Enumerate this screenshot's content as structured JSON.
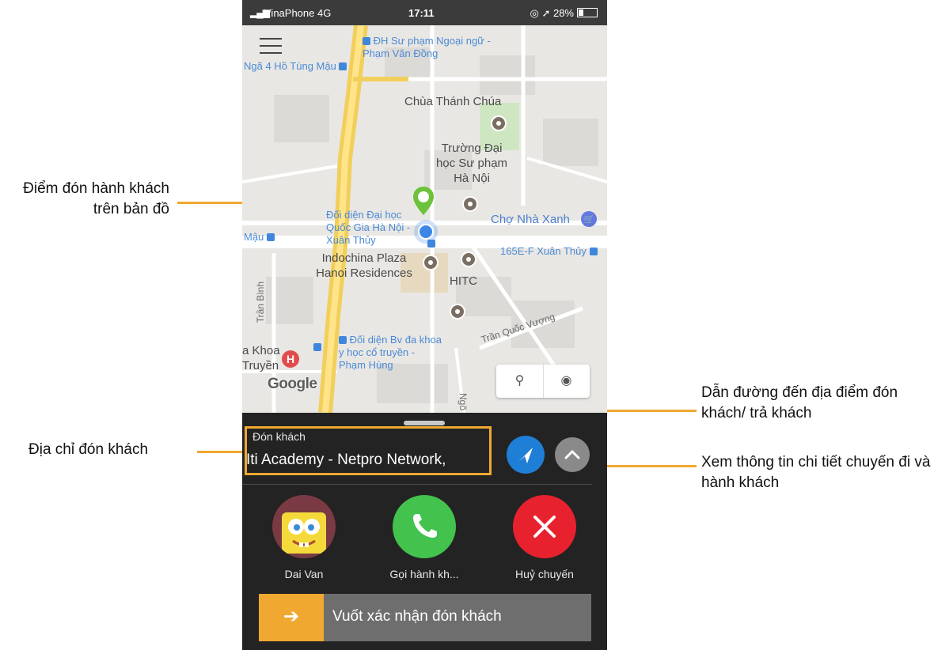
{
  "annotations": {
    "pickup_on_map": "Điểm đón hành khách trên bản đồ",
    "pickup_address": "Địa chỉ đón khách",
    "navigate": "Dẫn đường đến địa điểm đón khách/ trả khách",
    "trip_details": "Xem thông tin chi tiết chuyến đi và hành khách"
  },
  "status_bar": {
    "carrier": "VinaPhone  4G",
    "time": "17:11",
    "battery": "28%"
  },
  "map": {
    "pois": {
      "dhsp_ngoai_ngu": "ĐH Sư phạm Ngoại ngữ - Phạm Văn Đồng",
      "nga4_ho_tung_mau": "Ngã 4 Hồ Tùng Mậu",
      "chua": "Chùa Thánh Chúa",
      "truong": "Trường Đại học Sư phạm Hà Nội",
      "doi_dien_dhqg": "Đối diện Đại học Quốc Gia Hà Nội - Xuân Thủy",
      "cho_nha_xanh": "Chợ Nhà Xanh",
      "mau": "Mậu",
      "indochina": "Indochina Plaza Hanoi Residences",
      "stop_165": "165E-F Xuân Thủy",
      "hitc": "HITC",
      "tran_binh": "Trần Bình",
      "tran_quoc_vuong": "Trần Quốc Vượng",
      "doi_dien_bv": "Đối diện Bv đa khoa y học cổ truyền - Phạm Hùng",
      "khoa_truyen": "a Khoa Truyền",
      "ngo": "Ngõ"
    },
    "logo": "Google"
  },
  "sheet": {
    "address_label": "Đón khách",
    "address_value": "Iti Academy - Netpro Network,",
    "passenger_name": "Dai Van",
    "call_label": "Gọi hành kh...",
    "cancel_label": "Huỷ chuyến",
    "swipe_text": "Vuốt xác nhận đón khách"
  },
  "colors": {
    "accent": "#f0a830",
    "nav_blue": "#1f7fd6",
    "call_green": "#43c24d",
    "cancel_red": "#e8212e",
    "pickup_pin": "#6cc23a"
  }
}
